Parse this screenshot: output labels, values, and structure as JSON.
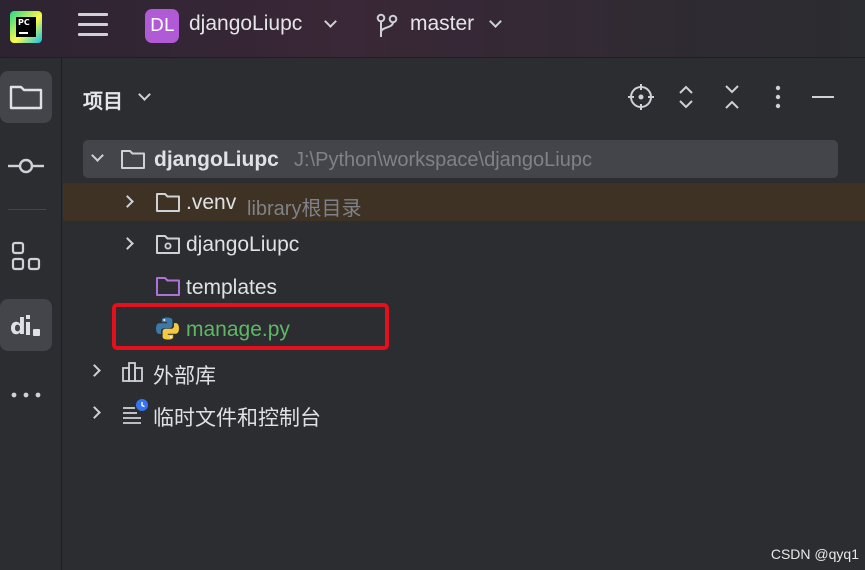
{
  "titlebar": {
    "app_logo_text": "PC",
    "project_initials": "DL",
    "project_name": "djangoLiupc",
    "branch_name": "master",
    "icons": [
      "pycharm-logo",
      "hamburger-menu-icon",
      "chevron-down-icon",
      "git-branch-icon"
    ]
  },
  "toolstrip": {
    "items": [
      {
        "name": "project",
        "icon": "folder-icon",
        "active": true
      },
      {
        "name": "commit",
        "icon": "commit-icon",
        "active": false
      },
      {
        "name": "structure",
        "icon": "structure-icon",
        "active": false
      },
      {
        "name": "django",
        "icon": "django-icon",
        "active": true
      },
      {
        "name": "more",
        "icon": "more-icon",
        "active": false
      }
    ]
  },
  "panel": {
    "title": "项目",
    "actions": [
      "locate-icon",
      "expand-all-icon",
      "collapse-all-icon",
      "more-vertical-icon",
      "minimize-icon"
    ]
  },
  "tree": {
    "root": {
      "name": "djangoLiupc",
      "path": "J:\\Python\\workspace\\djangoLiupc",
      "expanded": true
    },
    "items": [
      {
        "name": ".venv",
        "hint": "library根目录",
        "type": "folder"
      },
      {
        "name": "djangoLiupc",
        "type": "package-folder"
      },
      {
        "name": "templates",
        "type": "folder-templates"
      },
      {
        "name": "manage.py",
        "type": "python-file"
      }
    ],
    "external": "外部库",
    "scratches": "临时文件和控制台"
  },
  "watermark": "CSDN @qyq1",
  "colors": {
    "python_file_text": "#5fb865",
    "annotation_red": "#e3101d",
    "project_badge": "#b05ad5",
    "venv_row_highlight": "#3d3223"
  }
}
